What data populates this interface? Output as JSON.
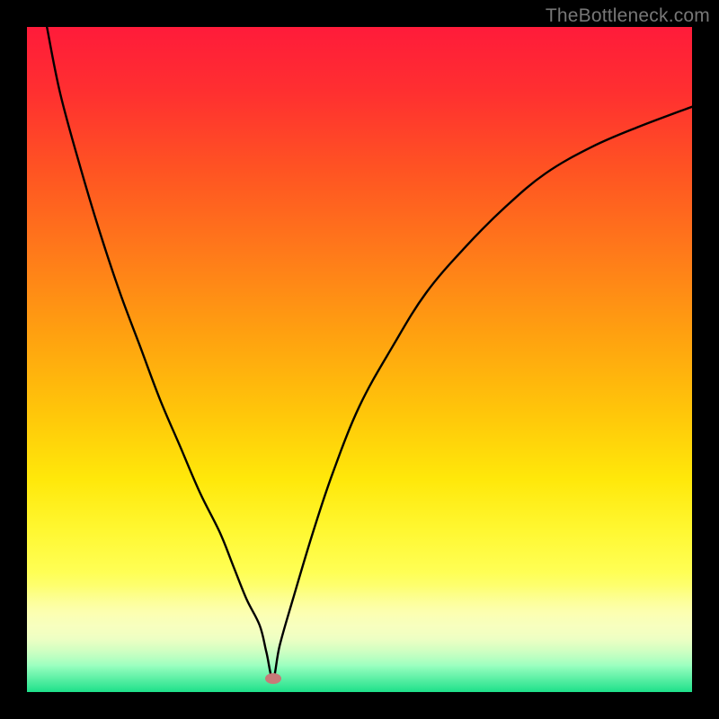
{
  "watermark": "TheBottleneck.com",
  "colors": {
    "frame": "#000000",
    "gradient_top": "#ff1b3a",
    "gradient_mid": "#ffe80a",
    "gradient_bottom": "#1ee08a",
    "curve": "#000000",
    "dot": "#c77a78"
  },
  "chart_data": {
    "type": "line",
    "title": "",
    "xlabel": "",
    "ylabel": "",
    "xlim": [
      0,
      100
    ],
    "ylim": [
      0,
      100
    ],
    "grid": false,
    "dot": {
      "x": 37,
      "y": 2
    },
    "series": [
      {
        "name": "curve",
        "x": [
          3,
          5,
          8,
          11,
          14,
          17,
          20,
          23,
          26,
          29,
          31,
          33,
          35,
          36,
          37,
          38,
          40,
          43,
          46,
          50,
          55,
          60,
          66,
          72,
          78,
          85,
          92,
          100
        ],
        "values": [
          100,
          90,
          79,
          69,
          60,
          52,
          44,
          37,
          30,
          24,
          19,
          14,
          10,
          6,
          2,
          7,
          14,
          24,
          33,
          43,
          52,
          60,
          67,
          73,
          78,
          82,
          85,
          88
        ]
      }
    ]
  }
}
